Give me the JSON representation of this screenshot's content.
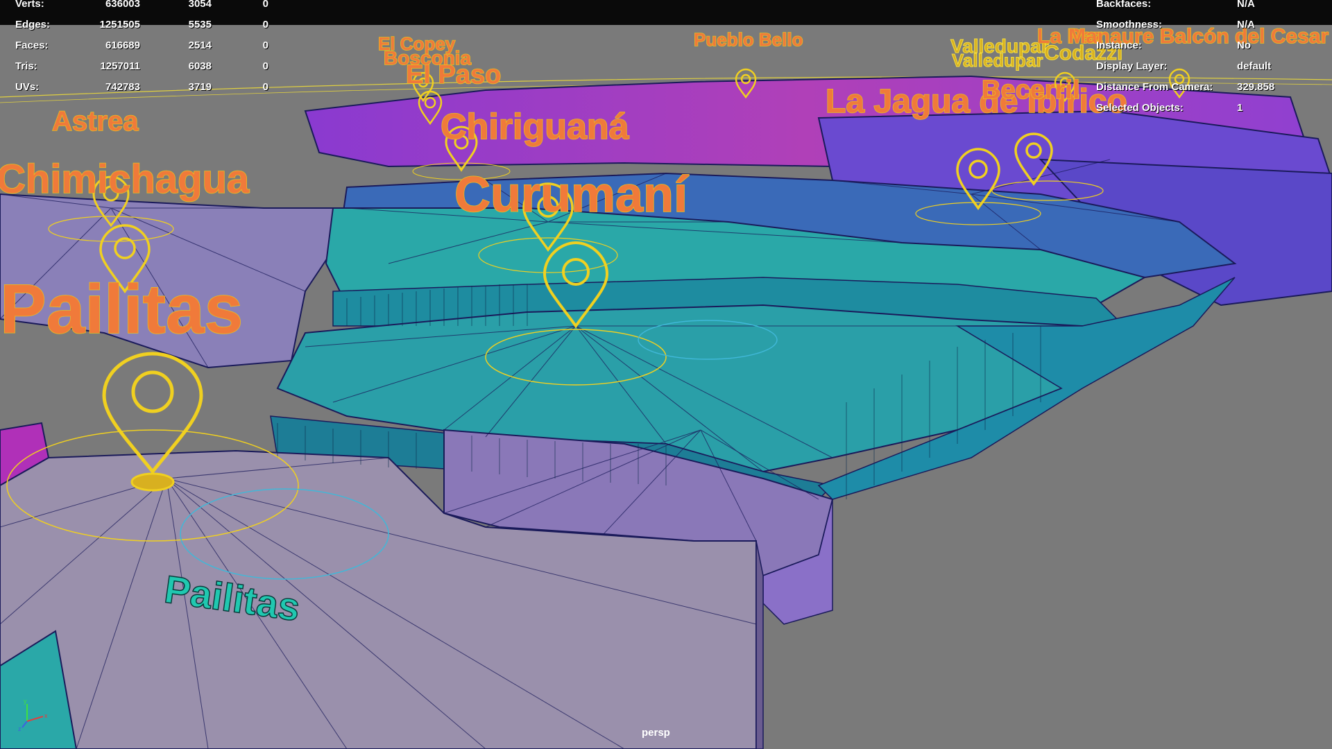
{
  "viewport": {
    "camera_label": "persp"
  },
  "poly_stats": {
    "rows": [
      {
        "label": "Verts:",
        "values": [
          "636003",
          "3054",
          "0"
        ]
      },
      {
        "label": "Edges:",
        "values": [
          "1251505",
          "5535",
          "0"
        ]
      },
      {
        "label": "Faces:",
        "values": [
          "616689",
          "2514",
          "0"
        ]
      },
      {
        "label": "Tris:",
        "values": [
          "1257011",
          "6038",
          "0"
        ]
      },
      {
        "label": "UVs:",
        "values": [
          "742783",
          "3719",
          "0"
        ]
      }
    ]
  },
  "object_info": {
    "rows": [
      {
        "label": "Backfaces:",
        "value": "N/A"
      },
      {
        "label": "Smoothness:",
        "value": "N/A"
      },
      {
        "label": "Instance:",
        "value": "No"
      },
      {
        "label": "Display Layer:",
        "value": "default"
      },
      {
        "label": "Distance From Camera:",
        "value": "329.858"
      },
      {
        "label": "Selected Objects:",
        "value": "1"
      }
    ]
  },
  "map_labels": {
    "pailitas_big": "Pailitas",
    "chimichagua": "Chimichagua",
    "astrea": "Astrea",
    "curumani": "Curumaní",
    "chiriguana": "Chiriguaná",
    "el_paso": "El Paso",
    "bosconia": "Bosconia",
    "el_copey": "El Copey",
    "pueblo_bello": "Pueblo Bello",
    "la_jagua": "La Jagua de Ibirico",
    "becerril": "Becerril",
    "valledupar_1": "Valledupar",
    "valledupar_2": "Valledupar",
    "la_paz": "La Paz",
    "codazzi": "Codazzi",
    "manaure": "Manaure Balcón del Cesar",
    "pailitas_mesh": "Pailitas"
  },
  "colors": {
    "background": "#7a7a7a",
    "region_teal": "#2aa8a8",
    "region_lavender": "#8878b8",
    "region_grey_purple": "#9a90b0",
    "region_magenta": "#b040b8",
    "region_violet": "#6a4ad0",
    "wire": "#1a1a5a",
    "pin_yellow": "#f0d020",
    "label_orange": "#f07a3a",
    "mesh_text_teal": "#20c8b0"
  },
  "icons": {
    "pin": "map-pin-icon",
    "axis": "axis-gizmo-icon"
  }
}
